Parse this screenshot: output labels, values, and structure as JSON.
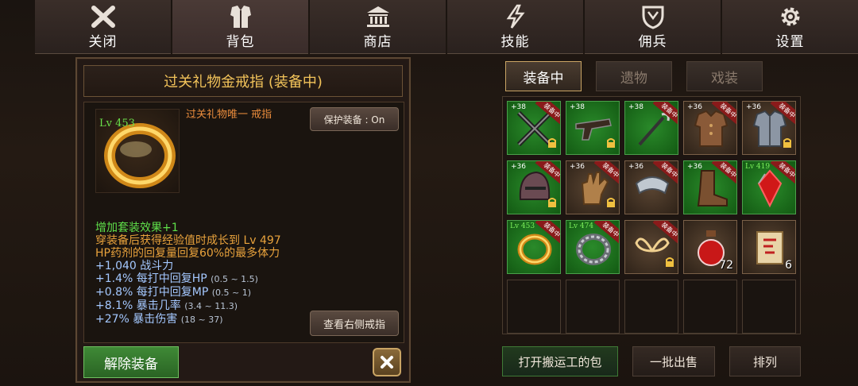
{
  "nav": [
    {
      "label": "关闭",
      "icon": "close-icon"
    },
    {
      "label": "背包",
      "icon": "armor-icon"
    },
    {
      "label": "商店",
      "icon": "shop-icon"
    },
    {
      "label": "技能",
      "icon": "skill-icon"
    },
    {
      "label": "佣兵",
      "icon": "shield-icon"
    },
    {
      "label": "设置",
      "icon": "gear-icon"
    }
  ],
  "item": {
    "title": "过关礼物金戒指 (装备中)",
    "level": "Lv 453",
    "name": "过关礼物唯一 戒指",
    "protect_label": "保护装备 : On",
    "stats": [
      {
        "text": "增加套装效果+1",
        "color": "g",
        "range": ""
      },
      {
        "text": "穿装备后获得经验值时成长到 Lv 497",
        "color": "o",
        "range": ""
      },
      {
        "text": "HP药剂的回复量回复60%的最多体力",
        "color": "o",
        "range": ""
      },
      {
        "text": "+1,040 战斗力",
        "color": "b",
        "range": ""
      },
      {
        "text": "+1.4% 每打中回复HP",
        "color": "b",
        "range": "(0.5 ~ 1.5)"
      },
      {
        "text": "+0.8% 每打中回复MP",
        "color": "b",
        "range": "(0.5 ~ 1)"
      },
      {
        "text": "+8.1% 暴击几率",
        "color": "b",
        "range": "(3.4 ~ 11.3)"
      },
      {
        "text": "+27% 暴击伤害",
        "color": "b",
        "range": "(18 ~ 37)"
      }
    ],
    "view_label": "查看右侧戒指",
    "unequip_label": "解除装备"
  },
  "tabs": [
    "装备中",
    "遗物",
    "戏装"
  ],
  "slots": [
    {
      "bg": "green",
      "plus": "+38",
      "ribbon": "装备中",
      "lock": true,
      "icon": "crossed-guns-icon"
    },
    {
      "bg": "green",
      "plus": "+38",
      "ribbon": "",
      "lock": true,
      "icon": "pistol-icon"
    },
    {
      "bg": "green",
      "plus": "+38",
      "ribbon": "装备中",
      "lock": false,
      "icon": "hook-staff-icon"
    },
    {
      "bg": "brown",
      "plus": "+36",
      "ribbon": "装备中",
      "lock": false,
      "icon": "leather-armor-icon"
    },
    {
      "bg": "brown",
      "plus": "+36",
      "ribbon": "装备中",
      "lock": true,
      "icon": "plate-armor-icon"
    },
    {
      "bg": "green",
      "plus": "+36",
      "ribbon": "装备中",
      "lock": true,
      "icon": "helmet-icon"
    },
    {
      "bg": "brown",
      "plus": "+36",
      "ribbon": "装备中",
      "lock": true,
      "icon": "glove-icon"
    },
    {
      "bg": "brown",
      "plus": "+36",
      "ribbon": "装备中",
      "lock": false,
      "icon": "bracer-icon"
    },
    {
      "bg": "green",
      "plus": "+36",
      "ribbon": "装备中",
      "lock": false,
      "icon": "boot-icon"
    },
    {
      "bg": "green",
      "lvtag": "Lv 419",
      "ribbon": "装备中",
      "lock": false,
      "icon": "red-gem-icon"
    },
    {
      "bg": "green",
      "lvtag": "Lv 453",
      "ribbon": "装备中",
      "lock": false,
      "icon": "gold-ring-icon"
    },
    {
      "bg": "green",
      "lvtag": "Lv 474",
      "ribbon": "装备中",
      "lock": false,
      "icon": "silver-ring-icon"
    },
    {
      "bg": "brown",
      "plus": "",
      "ribbon": "装备中",
      "lock": true,
      "icon": "wings-icon"
    },
    {
      "bg": "brown",
      "plus": "",
      "ribbon": "",
      "lock": false,
      "icon": "potion-icon",
      "count": "72"
    },
    {
      "bg": "brown",
      "plus": "",
      "ribbon": "",
      "lock": false,
      "icon": "scroll-icon",
      "count": "6"
    },
    {
      "bg": "empty"
    },
    {
      "bg": "empty"
    },
    {
      "bg": "empty"
    },
    {
      "bg": "empty"
    },
    {
      "bg": "empty"
    }
  ],
  "bottom": {
    "open_bag": "打开搬运工的包",
    "bulk_sell": "一批出售",
    "sort": "排列"
  }
}
